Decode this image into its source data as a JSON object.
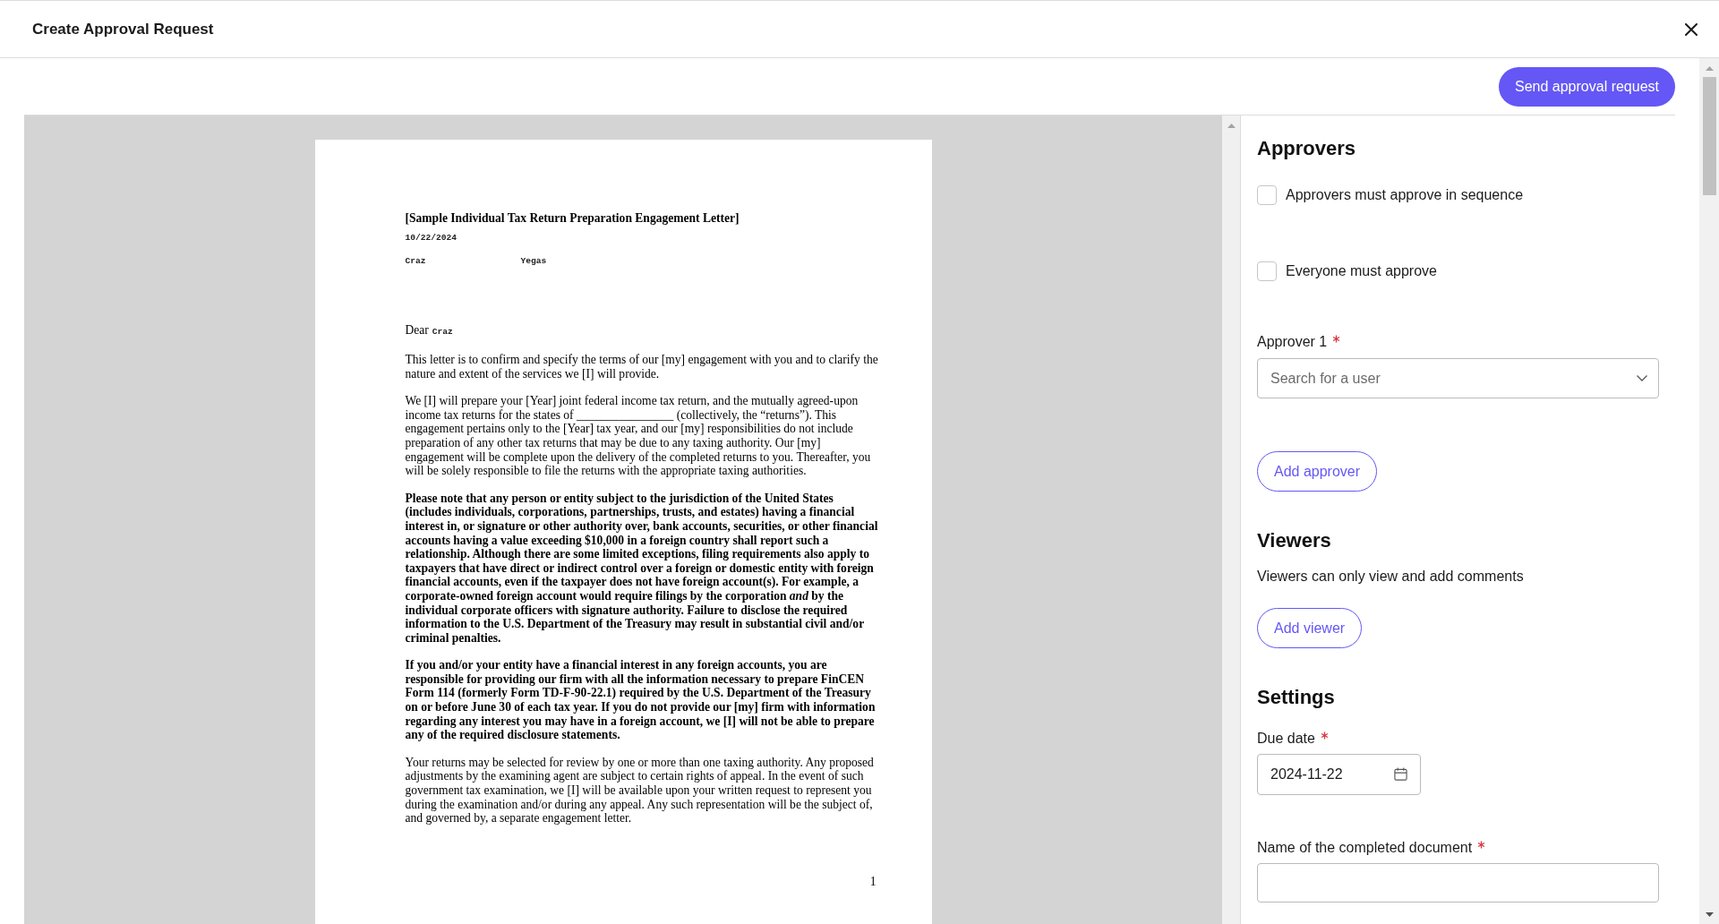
{
  "window": {
    "title": "Create Approval Request"
  },
  "toolbar": {
    "primary_button": "Send approval request"
  },
  "document": {
    "title": "[Sample Individual Tax Return Preparation Engagement Letter]",
    "date": "10/22/2024",
    "fields": [
      "Craz",
      "Yegas"
    ],
    "salutation": "Dear",
    "salutation_name": "Craz",
    "paragraphs": [
      {
        "kind": "plain",
        "text": "This letter is to confirm and specify the terms of our [my] engagement with you and to clarify the nature and extent of the services we [I] will provide."
      },
      {
        "kind": "plain",
        "text": "We [I] will prepare your [Year] joint federal income tax return, and the mutually agreed-upon income tax returns for the states of ________________ (collectively, the “returns”). This engagement pertains only to the [Year] tax year, and our [my] responsibilities do not include preparation of any other tax returns that may be due to any taxing authority. Our [my] engagement will be complete upon the delivery of the completed returns to you. Thereafter, you will be solely responsible to file the returns with the appropriate taxing authorities."
      },
      {
        "kind": "bold",
        "text": "Please note that any person or entity subject to the jurisdiction of the United States (includes individuals, corporations, partnerships, trusts, and estates) having a financial interest in, or signature or other authority over, bank accounts, securities, or other financial accounts having a value exceeding $10,000 in a foreign country shall report such a relationship. Although there are some limited exceptions, filing requirements also apply to taxpayers that have direct or indirect control over a foreign or domestic entity with foreign financial accounts, even if the taxpayer does not have foreign account(s). For example, a corporate-owned foreign account would require filings by the corporation *and* by the individual corporate officers with signature authority. Failure to disclose the required information to the U.S. Department of the Treasury may result in substantial civil and/or criminal penalties."
      },
      {
        "kind": "bold",
        "text": "If you and/or your entity have a financial interest in any foreign accounts, you are responsible for providing our firm with all the information necessary to prepare FinCEN Form 114 (formerly Form TD-F-90-22.1) required by the U.S. Department of the Treasury on or before June 30 of each tax year. If you do not provide our [my] firm with information regarding any interest you may have in a foreign account, we [I] will not be able to prepare any of the required disclosure statements."
      },
      {
        "kind": "plain",
        "text": "Your returns may be selected for review by one or more than one taxing authority. Any proposed adjustments by the examining agent are subject to certain rights of appeal. In the event of such government tax examination, we [I] will be available upon your written request to represent you during the examination and/or during any appeal. Any such representation will be the subject of, and governed by, a separate engagement letter."
      }
    ],
    "page_number": "1"
  },
  "approvers": {
    "heading": "Approvers",
    "options": [
      {
        "label": "Approvers must approve in sequence",
        "checked": false
      },
      {
        "label": "Everyone must approve",
        "checked": false
      }
    ],
    "approver_fields": [
      {
        "label": "Approver 1",
        "required": true,
        "placeholder": "Search for a user"
      }
    ],
    "add_button": "Add approver"
  },
  "viewers": {
    "heading": "Viewers",
    "description": "Viewers can only view and add comments",
    "add_button": "Add viewer"
  },
  "settings": {
    "heading": "Settings",
    "due_date": {
      "label": "Due date",
      "required": true,
      "value": "2024-11-22"
    },
    "document_name": {
      "label": "Name of the completed document",
      "required": true
    }
  }
}
